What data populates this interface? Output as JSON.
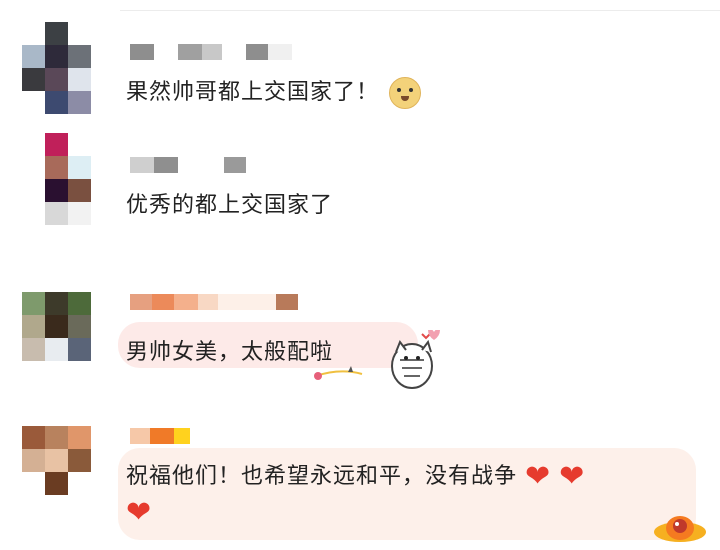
{
  "comments": [
    {
      "text": "果然帅哥都上交国家了！",
      "emoji": "doge-icon"
    },
    {
      "text": "优秀的都上交国家了"
    },
    {
      "text": "男帅女美，太般配啦",
      "sticker": "cat-sticker"
    },
    {
      "text_line1": "祝福他们！也希望永远和平，没有战争",
      "text_line2": "",
      "hearts": [
        "❤",
        "❤",
        "❤"
      ]
    }
  ],
  "colors": {
    "text": "#222222",
    "heart": "#e63b2e",
    "bubble_pink": "#fde8e6",
    "bubble_peach": "#fdf1e6"
  }
}
